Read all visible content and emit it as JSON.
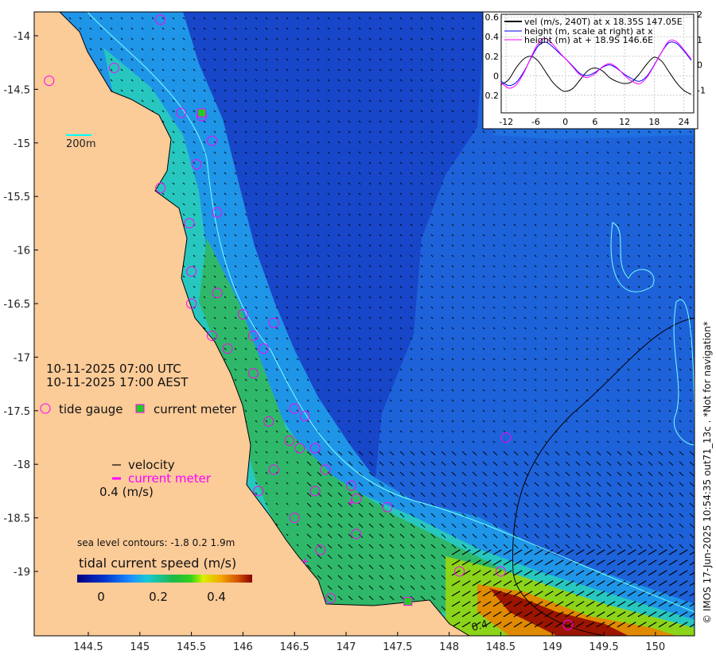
{
  "map": {
    "lon_ticks": [
      "144.5",
      "145",
      "145.5",
      "146",
      "146.5",
      "147",
      "147.5",
      "148",
      "148.5",
      "149",
      "149.5",
      "150"
    ],
    "lat_ticks": [
      "-14",
      "-14.5",
      "-15",
      "-15.5",
      "-16",
      "-16.5",
      "-17",
      "-17.5",
      "-18",
      "-18.5",
      "-19"
    ],
    "scale_label": "200m",
    "time_utc": "10-11-2025 07:00 UTC",
    "time_local": "10-11-2025 17:00 AEST",
    "legend_tide_gauge": "tide gauge",
    "legend_current_meter": "current meter",
    "legend_velocity": "velocity",
    "legend_current_meter_arrow": "current meter",
    "velocity_scale": "0.4 (m/s)",
    "contour_note": "sea level contours: -1.8 0.2 1.9m",
    "colorbar_title": "tidal current speed (m/s)",
    "colorbar_ticks": [
      "0",
      "0.2",
      "0.4"
    ],
    "contour_label": "0.4",
    "credit": "© IMOS 17-Jun-2025 10:54:35 out71_13c . *Not for navigation*",
    "colors": {
      "land": "#fbcb98",
      "deep": "#1846c8",
      "shelf": "#1f7ae6",
      "marker": "#ff00ff"
    }
  },
  "chart_data": {
    "type": "line",
    "x_ticks": [
      "-12",
      "-6",
      "0",
      "6",
      "12",
      "18",
      "24"
    ],
    "y_left_ticks": [
      "0.6",
      "0.4",
      "0.2",
      "0",
      "0.2"
    ],
    "y_right_ticks": [
      "2",
      "1",
      "0",
      "-1"
    ],
    "xlim": [
      -13,
      26
    ],
    "ylim_left": [
      -0.38,
      0.63
    ],
    "ylim_right": [
      -1.9,
      2.0
    ],
    "grid": true,
    "legend_placement": "top",
    "x": [
      -13,
      -11.5,
      -10,
      -8.5,
      -7,
      -5.5,
      -4,
      -2.5,
      -1,
      0,
      1.5,
      3,
      4.5,
      6,
      7.5,
      9,
      10.5,
      12,
      13.5,
      15,
      16.5,
      18,
      19.5,
      21,
      22.5,
      24,
      25.5
    ],
    "series": [
      {
        "name": "vel (m/s, 240T) at x 18.35S 147.05E",
        "axis": "left",
        "color": "#000000",
        "values": [
          -0.09,
          -0.04,
          0.08,
          0.17,
          0.2,
          0.15,
          0.04,
          -0.07,
          -0.14,
          -0.16,
          -0.13,
          -0.04,
          0.05,
          0.08,
          0.05,
          -0.02,
          -0.06,
          -0.08,
          -0.06,
          0.02,
          0.12,
          0.19,
          0.15,
          0.04,
          -0.07,
          -0.15,
          -0.19
        ]
      },
      {
        "name": "height (m, scale at right) at x",
        "axis": "right",
        "color": "#0000ff",
        "values": [
          -0.65,
          -0.82,
          -0.7,
          -0.3,
          0.25,
          0.75,
          0.9,
          0.7,
          0.42,
          0.25,
          -0.05,
          -0.35,
          -0.42,
          -0.3,
          -0.1,
          0.0,
          -0.15,
          -0.38,
          -0.55,
          -0.65,
          -0.45,
          0.0,
          0.5,
          0.88,
          0.85,
          0.55,
          0.18
        ]
      },
      {
        "name": "height (m) at + 18.9S 146.6E",
        "axis": "right",
        "color": "#ff00ff",
        "values": [
          -0.7,
          -0.92,
          -0.8,
          -0.35,
          0.28,
          0.85,
          1.05,
          0.8,
          0.45,
          0.25,
          -0.08,
          -0.4,
          -0.5,
          -0.35,
          -0.08,
          0.05,
          -0.12,
          -0.42,
          -0.65,
          -0.75,
          -0.5,
          -0.02,
          0.5,
          0.95,
          0.92,
          0.6,
          0.22
        ]
      }
    ]
  }
}
